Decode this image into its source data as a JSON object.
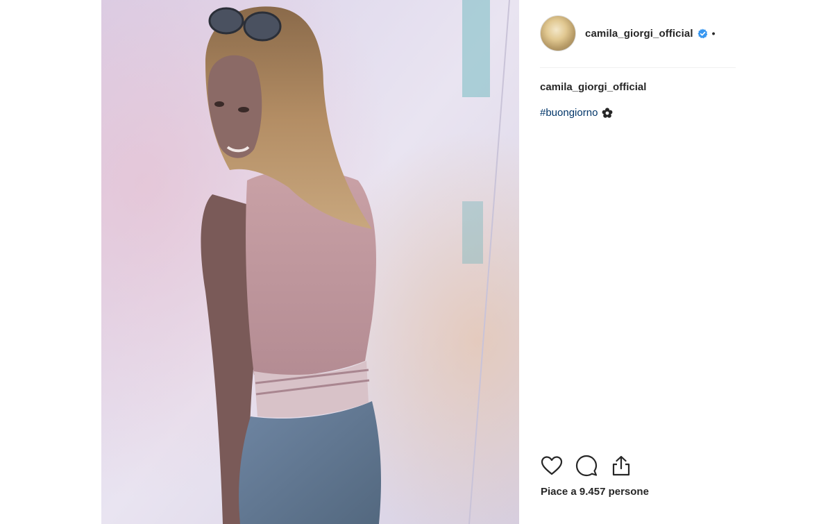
{
  "post": {
    "image_alt": "Photo posted by camila_giorgi_official",
    "colors": {
      "hashtag": "#003569",
      "verified_badge": "#3897f0",
      "text": "#262626"
    }
  },
  "header": {
    "username": "camila_giorgi_official",
    "separator": "•",
    "avatar_icon": "profile-avatar",
    "verified_icon": "verified-badge-icon"
  },
  "caption": {
    "username": "camila_giorgi_official",
    "hashtag": "#buongiorno",
    "emoji_icon": "flower-icon"
  },
  "actions": {
    "icons": [
      "heart-icon",
      "comment-icon",
      "share-icon"
    ]
  },
  "likes": {
    "text": "Piace a 9.457 persone"
  }
}
